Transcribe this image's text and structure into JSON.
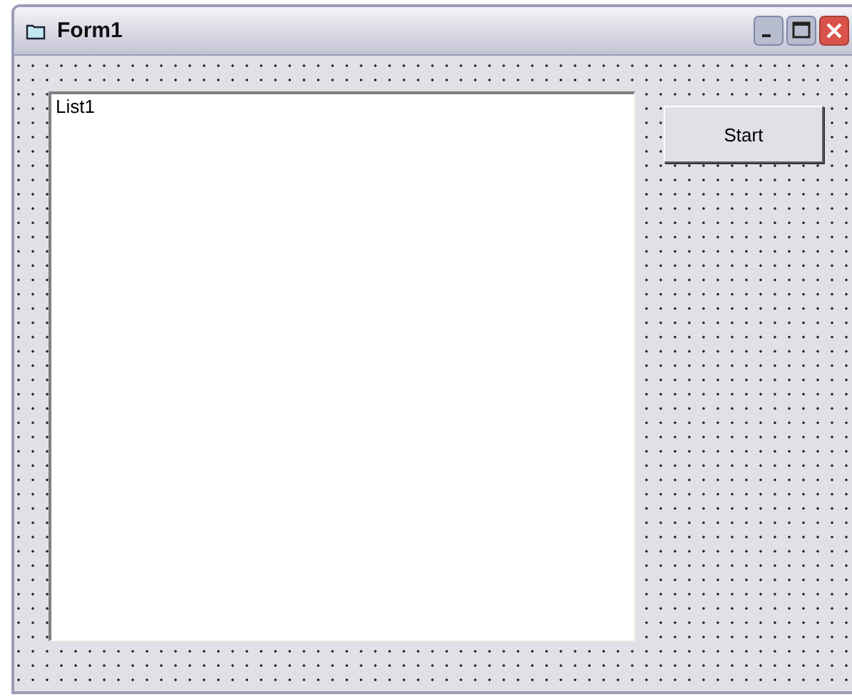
{
  "window": {
    "title": "Form1"
  },
  "list": {
    "items": [
      "List1"
    ]
  },
  "buttons": [
    "Start"
  ]
}
